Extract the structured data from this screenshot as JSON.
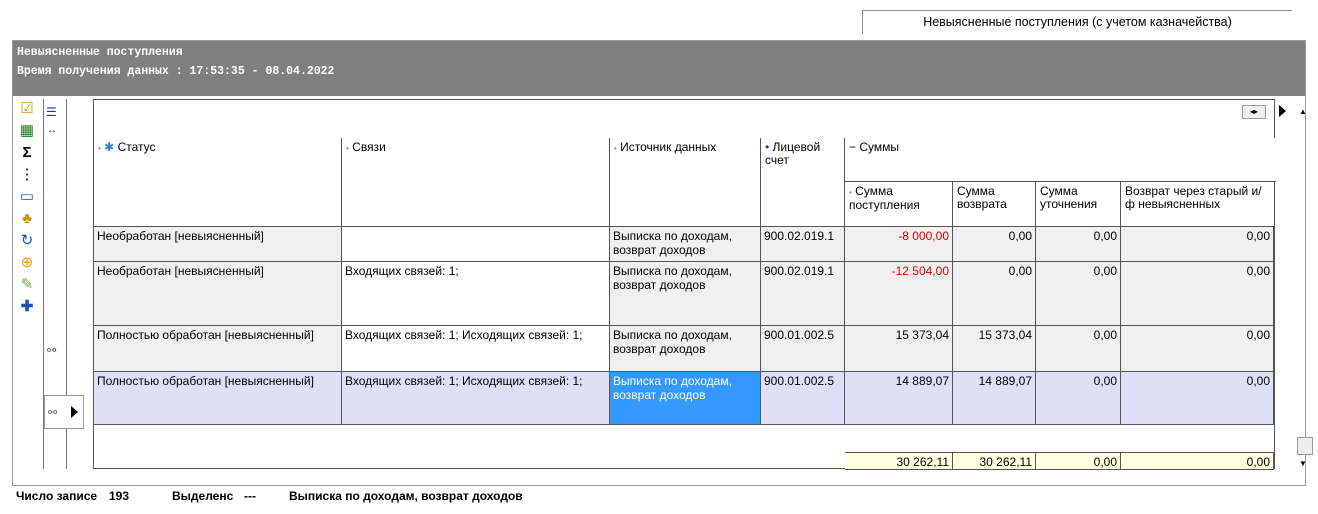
{
  "tab": {
    "title": "Невыясненные поступления (с учетом казначейства)"
  },
  "panel": {
    "title": "Невыясненные поступления",
    "time": "Время получения данных : 17:53:35 - 08.04.2022"
  },
  "toolbar": {
    "icons": [
      "checklist-icon",
      "excel-icon",
      "sum-icon",
      "tree-icon",
      "window-icon",
      "bell-icon",
      "refresh-icon",
      "lock-icon",
      "brush-icon",
      "add-icon"
    ]
  },
  "columns": {
    "status": "Статус",
    "links": "Связи",
    "source": "Источник данных",
    "account": "Лицевой счет",
    "sums_group": "Суммы",
    "sum_in": "Сумма поступления",
    "sum_ret": "Сумма возврата",
    "sum_clar": "Сумма уточнения",
    "sum_old": "Возврат через старый и/ф невыясненных"
  },
  "rows": [
    {
      "status": "Необработан [невыясненный]",
      "links": "",
      "source": "Выписка по доходам, возврат доходов",
      "account": "900.02.019.1",
      "sum_in": "-8 000,00",
      "sum_ret": "0,00",
      "sum_clar": "0,00",
      "sum_old": "0,00"
    },
    {
      "status": "Необработан [невыясненный]",
      "links": "Входящих связей: 1;",
      "source": "Выписка по доходам, возврат доходов",
      "account": "900.02.019.1",
      "sum_in": "-12 504,00",
      "sum_ret": "0,00",
      "sum_clar": "0,00",
      "sum_old": "0,00"
    },
    {
      "status": "Полностью обработан [невыясненный]",
      "links": "Входящих связей: 1; Исходящих связей: 1;",
      "source": "Выписка по доходам, возврат доходов",
      "account": "900.01.002.5",
      "sum_in": "15 373,04",
      "sum_ret": "15 373,04",
      "sum_clar": "0,00",
      "sum_old": "0,00"
    },
    {
      "status": "Полностью обработан [невыясненный]",
      "links": "Входящих связей: 1; Исходящих связей: 1;",
      "source": "Выписка по доходам, возврат доходов",
      "account": "900.01.002.5",
      "sum_in": "14 889,07",
      "sum_ret": "14 889,07",
      "sum_clar": "0,00",
      "sum_old": "0,00"
    }
  ],
  "totals": {
    "sum_in": "30 262,11",
    "sum_ret": "30 262,11",
    "sum_clar": "0,00",
    "sum_old": "0,00"
  },
  "status": {
    "count_label": "Число записе",
    "count_value": "193",
    "selected_label": "Выделенс",
    "selected_value": "---",
    "current": "Выписка по доходам, возврат доходов"
  },
  "colors": {
    "title_bg": "#7f7f7f",
    "selected_row": "#dde0f7",
    "highlight": "#3399ff",
    "negative": "#e00000",
    "totals_bg": "#ffffe1"
  }
}
